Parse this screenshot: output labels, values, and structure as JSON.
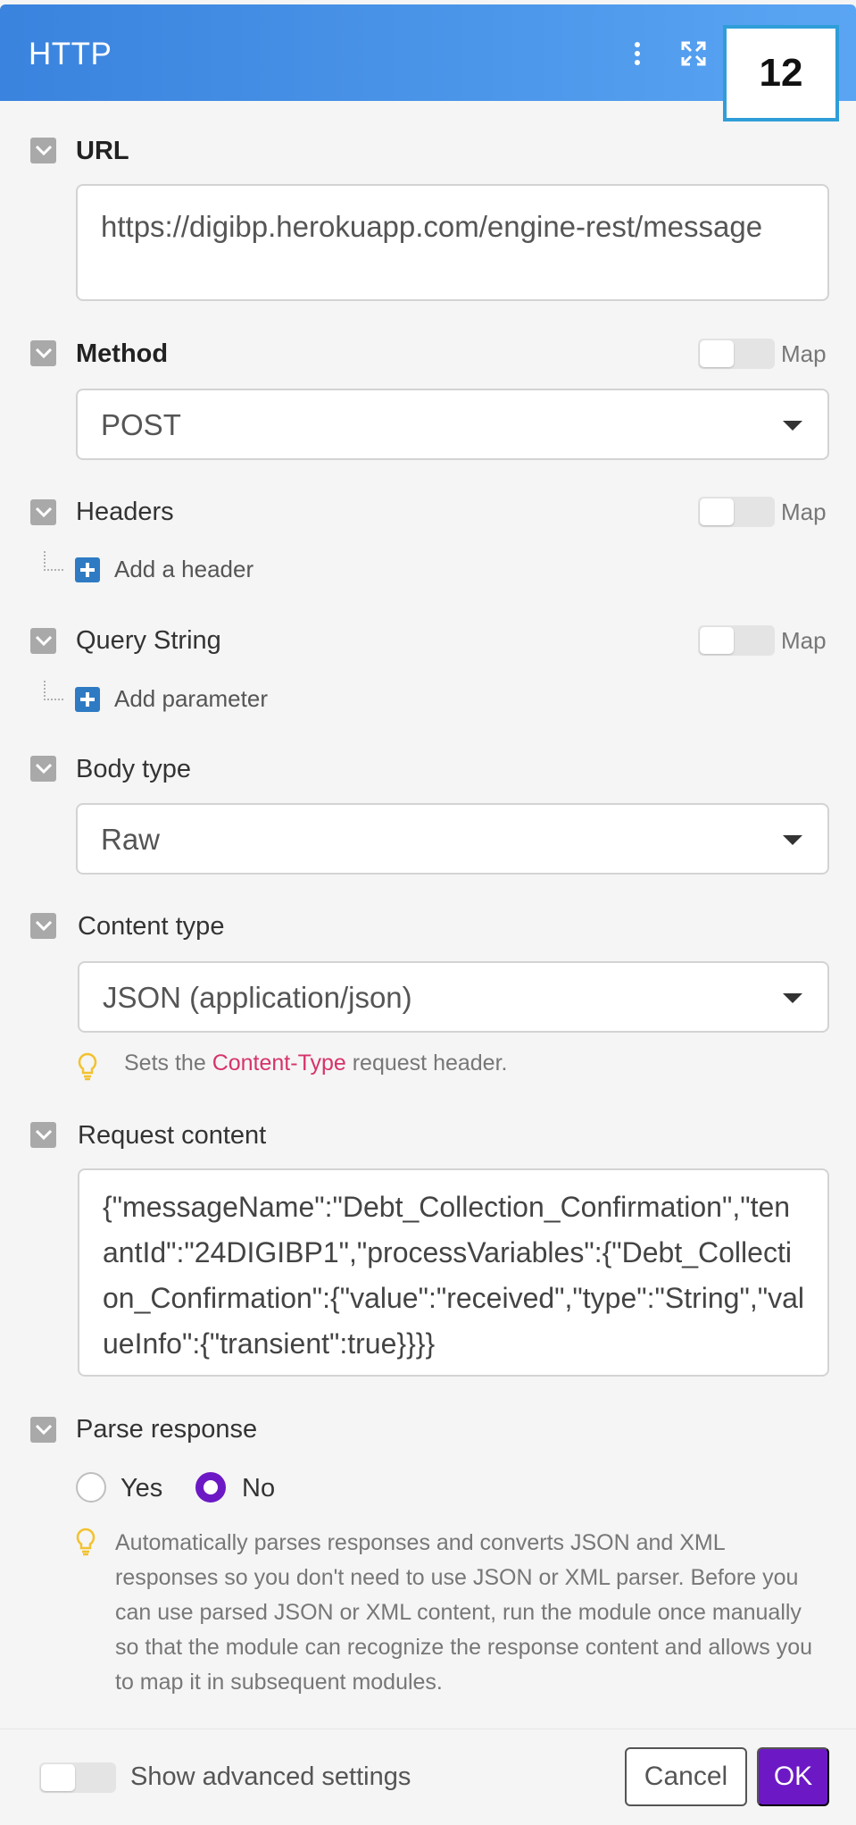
{
  "header": {
    "title": "HTTP",
    "badge": "12"
  },
  "url": {
    "label": "URL",
    "value": "https://digibp.herokuapp.com/engine-rest/message"
  },
  "method": {
    "label": "Method",
    "value": "POST",
    "map_label": "Map"
  },
  "headers": {
    "label": "Headers",
    "map_label": "Map",
    "add_label": "Add a header"
  },
  "query_string": {
    "label": "Query String",
    "map_label": "Map",
    "add_label": "Add parameter"
  },
  "body_type": {
    "label": "Body type",
    "value": "Raw"
  },
  "content_type": {
    "label": "Content type",
    "value": "JSON (application/json)",
    "hint_prefix": "Sets the",
    "hint_code": "Content-Type",
    "hint_suffix": "request header."
  },
  "request_content": {
    "label": "Request content",
    "value": "{\"messageName\":\"Debt_Collection_Confirmation\",\"tenantId\":\"24DIGIBP1\",\"processVariables\":{\"Debt_Collection_Confirmation\":{\"value\":\"received\",\"type\":\"String\",\"valueInfo\":{\"transient\":true}}}}"
  },
  "parse_response": {
    "label": "Parse response",
    "options": [
      "Yes",
      "No"
    ],
    "selected": "No",
    "hint": "Automatically parses responses and converts JSON and XML responses so you don't need to use JSON or XML parser. Before you can use parsed JSON or XML content, run the module once manually so that the module can recognize the response content and allows you to map it in subsequent modules."
  },
  "footer": {
    "advanced_label": "Show advanced settings",
    "cancel_label": "Cancel",
    "ok_label": "OK"
  },
  "colors": {
    "header_start": "#3a83de",
    "header_end": "#5aa5f3",
    "accent": "#6c19c5",
    "badge_border": "#2f9ed8"
  },
  "icons": [
    "kebab-menu-icon",
    "expand-icon",
    "check-icon",
    "plus-icon",
    "lightbulb-icon",
    "caret-down-icon"
  ]
}
